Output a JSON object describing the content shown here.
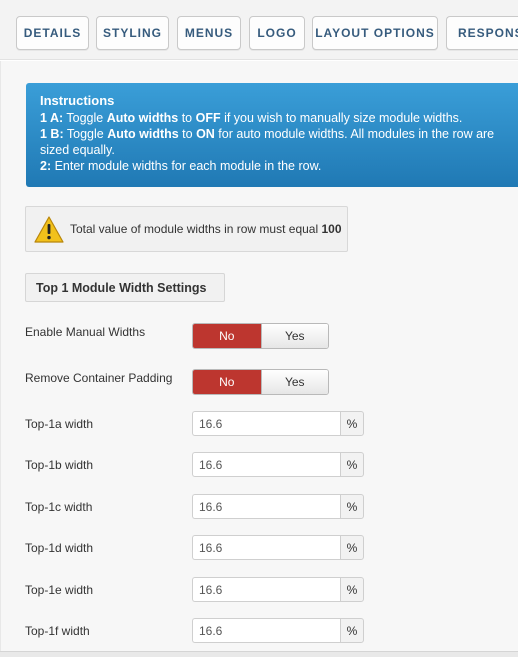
{
  "tabs": [
    {
      "label": "DETAILS"
    },
    {
      "label": "STYLING"
    },
    {
      "label": "MENUS"
    },
    {
      "label": "LOGO"
    },
    {
      "label": "LAYOUT OPTIONS"
    },
    {
      "label": "RESPONSI"
    }
  ],
  "instructions": {
    "title": "Instructions",
    "line1_prefix": "1 A:",
    "line1_a": " Toggle ",
    "line1_bold1": "Auto widths",
    "line1_b": " to ",
    "line1_bold2": "OFF",
    "line1_c": " if you wish to manually size module widths.",
    "line2_prefix": "1 B:",
    "line2_a": " Toggle ",
    "line2_bold1": "Auto widths",
    "line2_b": " to ",
    "line2_bold2": "ON",
    "line2_c": " for auto module widths. All modules in the row are sized equally.",
    "line3_prefix": "2:",
    "line3_a": " Enter module widths for each module in the row."
  },
  "warning": {
    "text": "Total value of module widths in row must equal ",
    "value": "100",
    "icon": "warning-triangle-icon",
    "icon_color": "#f2c11b"
  },
  "section": {
    "title": "Top 1 Module Width Settings"
  },
  "manual_widths": {
    "label": "Enable Manual Widths",
    "no": "No",
    "yes": "Yes",
    "selected": "No"
  },
  "container_padding": {
    "label": "Remove Container Padding",
    "no": "No",
    "yes": "Yes",
    "selected": "No"
  },
  "widths": [
    {
      "label": "Top-1a width",
      "value": "16.6",
      "unit": "%"
    },
    {
      "label": "Top-1b width",
      "value": "16.6",
      "unit": "%"
    },
    {
      "label": "Top-1c width",
      "value": "16.6",
      "unit": "%"
    },
    {
      "label": "Top-1d width",
      "value": "16.6",
      "unit": "%"
    },
    {
      "label": "Top-1e width",
      "value": "16.6",
      "unit": "%"
    },
    {
      "label": "Top-1f width",
      "value": "16.6",
      "unit": "%"
    }
  ],
  "colors": {
    "accent_blue": "#2f8fcc",
    "toggle_active": "#bd362f",
    "tab_text": "#365b7d"
  }
}
